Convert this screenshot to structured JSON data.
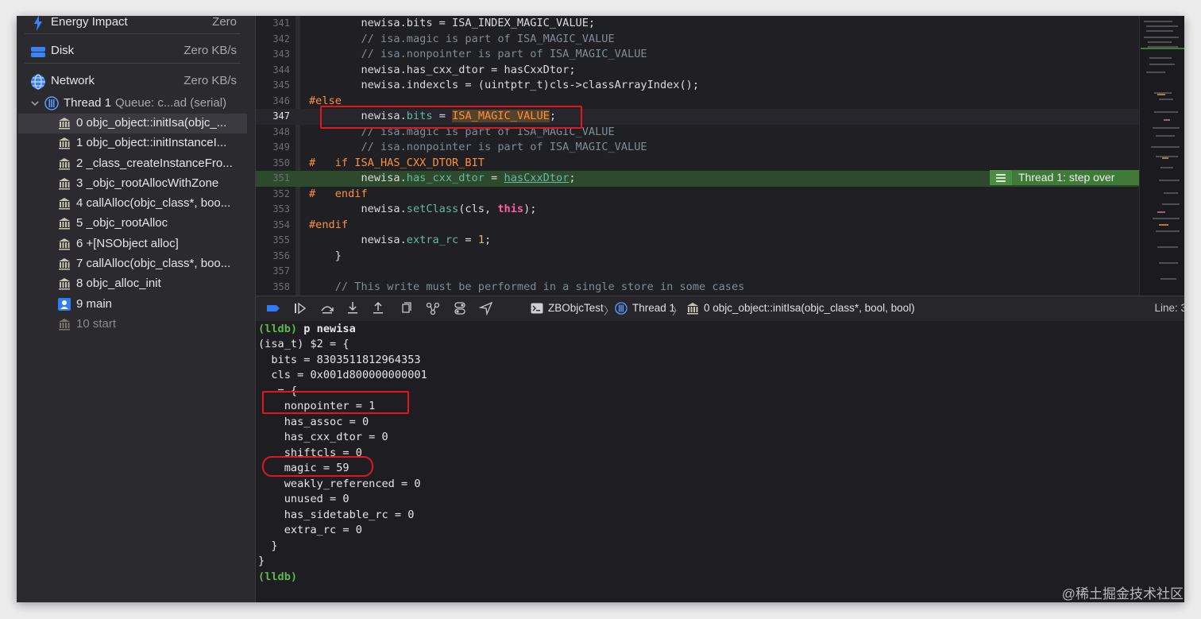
{
  "navigator": {
    "gauges": [
      {
        "label": "Energy Impact",
        "value": "Zero"
      },
      {
        "label": "Disk",
        "value": "Zero KB/s"
      },
      {
        "label": "Network",
        "value": "Zero KB/s"
      }
    ],
    "thread": {
      "name": "Thread 1",
      "queue": "Queue: c...ad (serial)"
    },
    "frames": [
      {
        "label": "0 objc_object::initIsa(objc_...",
        "icon": "framework-icon"
      },
      {
        "label": "1 objc_object::initInstanceI...",
        "icon": "framework-icon"
      },
      {
        "label": "2 _class_createInstanceFro...",
        "icon": "framework-icon"
      },
      {
        "label": "3 _objc_rootAllocWithZone",
        "icon": "framework-icon"
      },
      {
        "label": "4 callAlloc(objc_class*, boo...",
        "icon": "framework-icon"
      },
      {
        "label": "5 _objc_rootAlloc",
        "icon": "framework-icon"
      },
      {
        "label": "6 +[NSObject alloc]",
        "icon": "framework-icon"
      },
      {
        "label": "7 callAlloc(objc_class*, boo...",
        "icon": "framework-icon"
      },
      {
        "label": "8 objc_alloc_init",
        "icon": "framework-icon"
      },
      {
        "label": "9 main",
        "icon": "user-code-icon"
      },
      {
        "label": "10 start",
        "icon": "framework-icon"
      }
    ]
  },
  "editor": {
    "lines": [
      {
        "n": "341",
        "text": "        newisa.bits = ISA_INDEX_MAGIC_VALUE;"
      },
      {
        "n": "342",
        "text": "        // isa.magic is part of ISA_MAGIC_VALUE"
      },
      {
        "n": "343",
        "text": "        // isa.nonpointer is part of ISA_MAGIC_VALUE"
      },
      {
        "n": "344",
        "text": "        newisa.has_cxx_dtor = hasCxxDtor;"
      },
      {
        "n": "345",
        "text": "        newisa.indexcls = (uintptr_t)cls->classArrayIndex();"
      },
      {
        "n": "346",
        "text": "#else"
      },
      {
        "n": "347",
        "pre": "        newisa.",
        "prop": "bits",
        "mid": " = ",
        "mac": "ISA_MAGIC_VALUE",
        "post": ";"
      },
      {
        "n": "348",
        "text": "        // isa.magic is part of ISA_MAGIC_VALUE"
      },
      {
        "n": "349",
        "text": "        // isa.nonpointer is part of ISA_MAGIC_VALUE"
      },
      {
        "n": "350",
        "text": "#   if ISA_HAS_CXX_DTOR_BIT"
      },
      {
        "n": "351",
        "pre": "        newisa.",
        "prop": "has_cxx_dtor",
        "mid": " = ",
        "ul": "hasCxxDtor",
        "post": ";"
      },
      {
        "n": "352",
        "text": "#   endif"
      },
      {
        "n": "353",
        "pre": "        newisa.",
        "prop": "setClass",
        "mid": "(cls, ",
        "kw": "this",
        "post": ");"
      },
      {
        "n": "354",
        "text": "#endif"
      },
      {
        "n": "355",
        "pre": "        newisa.",
        "prop": "extra_rc",
        "mid": " = ",
        "num": "1",
        "post": ";"
      },
      {
        "n": "356",
        "text": "    }"
      },
      {
        "n": "357",
        "text": ""
      },
      {
        "n": "358",
        "text": "    // This write must be performed in a single store in some cases"
      }
    ],
    "exec_badge": "Thread 1: step over"
  },
  "debug_bar": {
    "breadcrumb": [
      "ZBObjcTest",
      "Thread 1",
      "0 objc_object::initIsa(objc_class*, bool, bool)"
    ],
    "line": "Line: 3"
  },
  "console": {
    "lines": [
      {
        "prompt": "(lldb)",
        "cmd": " p newisa"
      },
      {
        "text": "(isa_t) $2 = {"
      },
      {
        "text": "  bits = 8303511812964353"
      },
      {
        "text": "  cls = 0x001d800000000001"
      },
      {
        "text": "   = {"
      },
      {
        "text": "    nonpointer = 1"
      },
      {
        "text": "    has_assoc = 0"
      },
      {
        "text": "    has_cxx_dtor = 0"
      },
      {
        "text": "    shiftcls = 0"
      },
      {
        "text": "    magic = 59"
      },
      {
        "text": "    weakly_referenced = 0"
      },
      {
        "text": "    unused = 0"
      },
      {
        "text": "    has_sidetable_rc = 0"
      },
      {
        "text": "    extra_rc = 0"
      },
      {
        "text": "  }"
      },
      {
        "text": "}"
      },
      {
        "prompt": "(lldb)",
        "cmd": ""
      }
    ]
  },
  "watermark": "@稀土掘金技术社区",
  "colors": {
    "prompt": "#5fb84a",
    "exec_line": "#2e4a2c",
    "annotation": "#e0171d",
    "badge": "#3f7a39"
  }
}
